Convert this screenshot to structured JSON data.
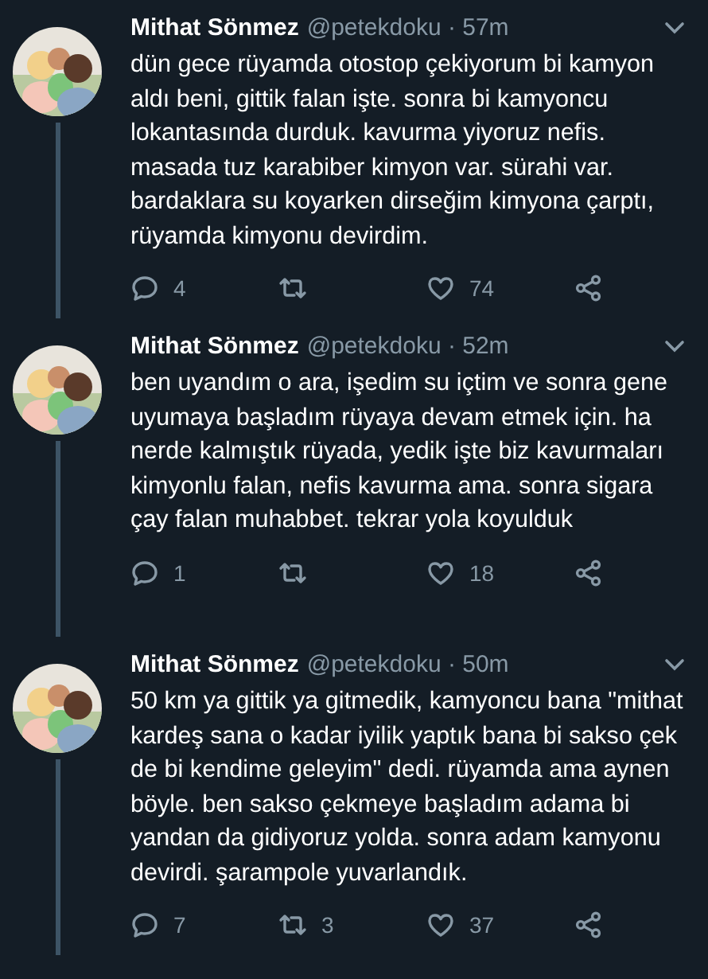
{
  "tweets": [
    {
      "name": "Mithat Sönmez",
      "meta": "@petekdoku · 57m",
      "text": "dün gece rüyamda otostop çekiyorum bi kamyon aldı beni, gittik falan işte. sonra bi kamyoncu lokantasında durduk. kavurma yiyoruz nefis. masada tuz karabiber kimyon var. sürahi var. bardaklara su koyarken dirseğim kimyona çarptı, rüyamda kimyonu devirdim.",
      "replies": "4",
      "likes": "74"
    },
    {
      "name": "Mithat Sönmez",
      "meta": "@petekdoku · 52m",
      "text": "ben uyandım o ara, işedim su içtim ve sonra gene uyumaya başladım rüyaya devam etmek için. ha nerde kalmıştık rüyada, yedik işte biz kavurmaları kimyonlu falan, nefis kavurma ama. sonra sigara çay falan muhabbet. tekrar yola koyulduk",
      "replies": "1",
      "likes": "18"
    },
    {
      "name": "Mithat Sönmez",
      "meta": "@petekdoku · 50m",
      "text": "50 km ya gittik ya gitmedik, kamyoncu bana \"mithat kardeş sana o kadar iyilik yaptık bana bi sakso çek de bi kendime geleyim\" dedi. rüyamda ama aynen böyle. ben sakso çekmeye başladım adama bi yandan da gidiyoruz yolda. sonra adam kamyonu devirdi. şarampole yuvarlandık.",
      "replies": "7",
      "retweets": "3",
      "likes": "37"
    }
  ]
}
